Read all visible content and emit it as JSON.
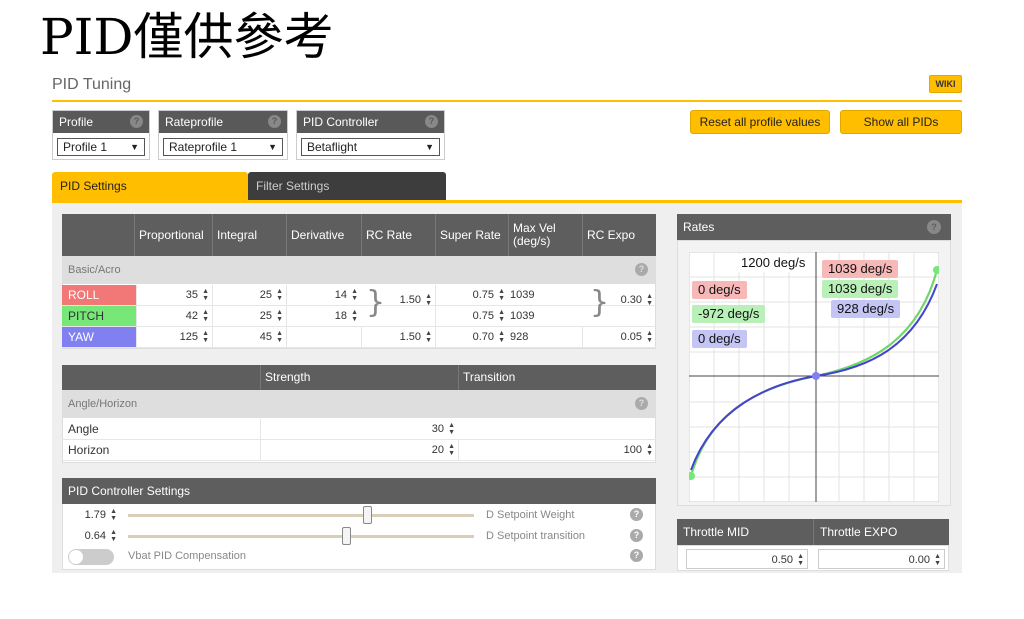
{
  "banner": "PID僅供參考",
  "page_title": "PID Tuning",
  "wiki_label": "WIKI",
  "help_glyph": "?",
  "selectors": {
    "profile": {
      "label": "Profile",
      "value": "Profile 1"
    },
    "rateprofile": {
      "label": "Rateprofile",
      "value": "Rateprofile 1"
    },
    "controller": {
      "label": "PID Controller",
      "value": "Betaflight"
    }
  },
  "buttons": {
    "reset": "Reset all profile values",
    "show_all": "Show all PIDs"
  },
  "tabs": {
    "pid": "PID Settings",
    "filter": "Filter Settings"
  },
  "pid_table": {
    "headers": {
      "proportional": "Proportional",
      "integral": "Integral",
      "derivative": "Derivative",
      "rc_rate": "RC Rate",
      "super_rate": "Super Rate",
      "max_vel": "Max Vel (deg/s)",
      "rc_expo": "RC Expo"
    },
    "section": "Basic/Acro",
    "rows": [
      {
        "name": "ROLL",
        "color": "#f27777",
        "p": "35",
        "i": "25",
        "d": "14",
        "super_rate": "0.75",
        "max_vel": "1039"
      },
      {
        "name": "PITCH",
        "color": "#77e877",
        "p": "42",
        "i": "25",
        "d": "18",
        "super_rate": "0.75",
        "max_vel": "1039"
      },
      {
        "name": "YAW",
        "color": "#8080f0",
        "p": "125",
        "i": "45",
        "rc_rate": "1.50",
        "super_rate": "0.70",
        "max_vel": "928",
        "rc_expo": "0.05"
      }
    ],
    "rollpitch_rc_rate": "1.50",
    "rollpitch_rc_expo": "0.30"
  },
  "angle_table": {
    "headers": {
      "strength": "Strength",
      "transition": "Transition"
    },
    "section": "Angle/Horizon",
    "rows": [
      {
        "name": "Angle",
        "strength": "30",
        "transition": ""
      },
      {
        "name": "Horizon",
        "strength": "20",
        "transition": "100"
      }
    ]
  },
  "controller_settings": {
    "title": "PID Controller Settings",
    "setpoint_weight": {
      "value": "1.79",
      "label": "D Setpoint Weight",
      "position": 0.69
    },
    "setpoint_transition": {
      "value": "0.64",
      "label": "D Setpoint transition",
      "position": 0.63
    },
    "vbat_label": "Vbat PID Compensation"
  },
  "rates": {
    "title": "Rates",
    "max_label": "1200 deg/s",
    "labels": [
      {
        "text": "1039 deg/s",
        "color": "#f7b8b8"
      },
      {
        "text": "1039 deg/s",
        "color": "#b8f0b8"
      },
      {
        "text": "928 deg/s",
        "color": "#c4c4f5"
      },
      {
        "text": "0 deg/s",
        "color": "#f7b8b8"
      },
      {
        "text": "-972 deg/s",
        "color": "#b8f0b8"
      },
      {
        "text": "0 deg/s",
        "color": "#c4c4f5"
      }
    ]
  },
  "throttle": {
    "mid_label": "Throttle MID",
    "expo_label": "Throttle EXPO",
    "mid_value": "0.50",
    "expo_value": "0.00"
  }
}
